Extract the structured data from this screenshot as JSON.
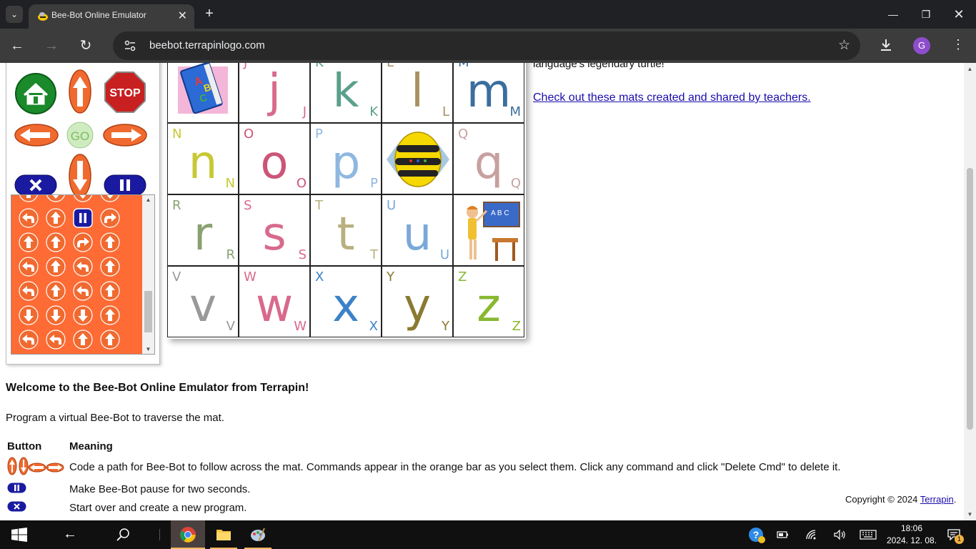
{
  "browser": {
    "tab_title": "Bee-Bot Online Emulator",
    "url": "beebot.terrapinlogo.com",
    "profile_initial": "G"
  },
  "page": {
    "intro_tail": "language's legendary turtle!",
    "teacher_link": "Check out these mats created and shared by teachers.",
    "welcome": "Welcome to the Bee-Bot Online Emulator from Terrapin!",
    "program": "Program a virtual Bee-Bot to traverse the mat.",
    "table": {
      "header_button": "Button",
      "header_meaning": "Meaning",
      "rows": [
        "Code a path for Bee-Bot to follow across the mat. Commands appear in the orange bar as you select them. Click any command and click \"Delete Cmd\" to delete it.",
        "Make Bee-Bot pause for two seconds.",
        "Start over and create a new program."
      ]
    },
    "copyright_prefix": "Copyright © 2024 ",
    "copyright_link": "Terrapin",
    "copyright_suffix": "."
  },
  "controls": {
    "go_label": "GO",
    "stop_label": "STOP"
  },
  "mat": {
    "rows": [
      [
        {
          "type": "image",
          "icon": "abc-book-icon"
        },
        {
          "letter": "j",
          "upper": "J",
          "color": "#d86a8c"
        },
        {
          "letter": "k",
          "upper": "K",
          "color": "#5aa08a"
        },
        {
          "letter": "l",
          "upper": "L",
          "color": "#a89060"
        },
        {
          "letter": "m",
          "upper": "M",
          "color": "#3b6e9e"
        }
      ],
      [
        {
          "letter": "n",
          "upper": "N",
          "color": "#c8c834"
        },
        {
          "letter": "o",
          "upper": "O",
          "color": "#cc5577"
        },
        {
          "letter": "p",
          "upper": "P",
          "color": "#8fb8e0"
        },
        {
          "type": "image",
          "icon": "bee-bot-icon"
        },
        {
          "letter": "q",
          "upper": "Q",
          "color": "#c8a0a0"
        }
      ],
      [
        {
          "letter": "r",
          "upper": "R",
          "color": "#8aa070"
        },
        {
          "letter": "s",
          "upper": "S",
          "color": "#d86a8c"
        },
        {
          "letter": "t",
          "upper": "T",
          "color": "#b8b080"
        },
        {
          "letter": "u",
          "upper": "U",
          "color": "#7aa8d8"
        },
        {
          "type": "image",
          "icon": "teacher-icon"
        }
      ],
      [
        {
          "letter": "v",
          "upper": "V",
          "color": "#999999"
        },
        {
          "letter": "w",
          "upper": "W",
          "color": "#d86a8c"
        },
        {
          "letter": "x",
          "upper": "X",
          "color": "#3c82c8"
        },
        {
          "letter": "y",
          "upper": "Y",
          "color": "#8a7a30"
        },
        {
          "letter": "z",
          "upper": "Z",
          "color": "#88b830"
        }
      ]
    ]
  },
  "commands": {
    "rows": [
      [
        "left",
        "up",
        "pause",
        "right"
      ],
      [
        "up",
        "up",
        "right",
        "up"
      ],
      [
        "left",
        "up",
        "left",
        "up"
      ],
      [
        "left",
        "up",
        "left",
        "up"
      ],
      [
        "down",
        "down",
        "down",
        "up"
      ],
      [
        "left",
        "left",
        "up",
        "up"
      ]
    ]
  },
  "taskbar": {
    "time": "18:06",
    "date": "2024. 12. 08.",
    "notification_count": "1"
  }
}
